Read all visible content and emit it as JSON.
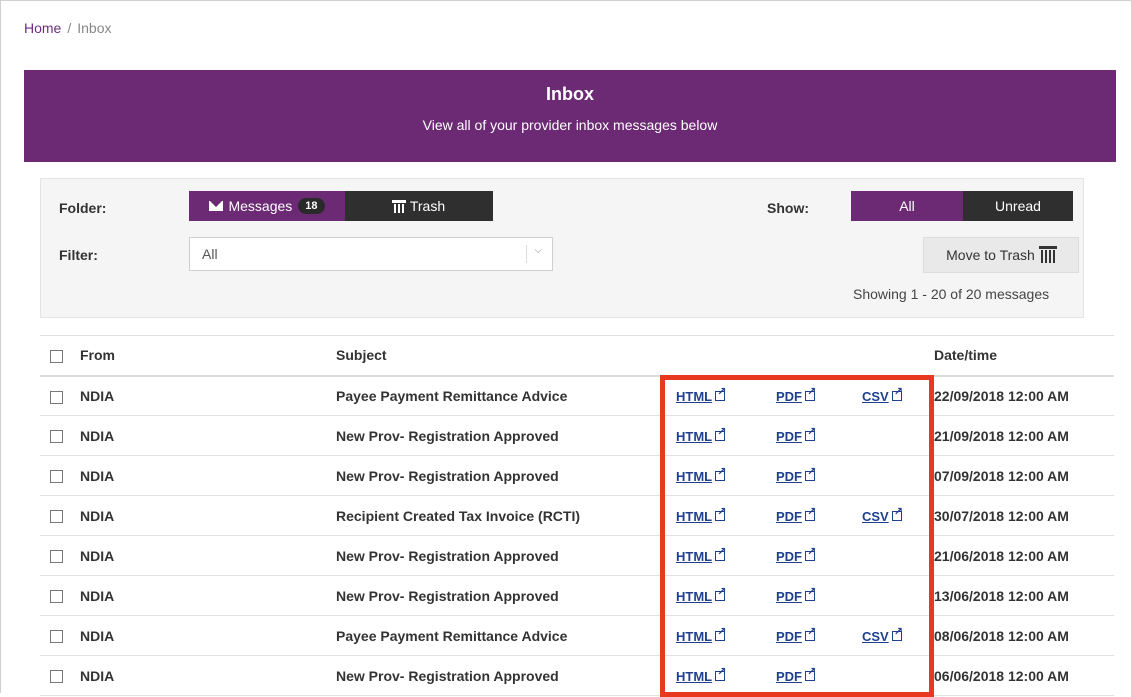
{
  "breadcrumb": {
    "home": "Home",
    "separator": "/",
    "current": "Inbox"
  },
  "banner": {
    "title": "Inbox",
    "subtitle": "View all of your provider inbox messages below"
  },
  "controls": {
    "folder_label": "Folder:",
    "messages_label": "Messages",
    "messages_count": "18",
    "trash_label": "Trash",
    "show_label": "Show:",
    "show_all": "All",
    "show_unread": "Unread",
    "filter_label": "Filter:",
    "filter_value": "All",
    "move_to_trash": "Move to Trash",
    "showing_text": "Showing 1 - 20 of 20 messages"
  },
  "table": {
    "headers": {
      "from": "From",
      "subject": "Subject",
      "datetime": "Date/time"
    },
    "links": {
      "html": "HTML",
      "pdf": "PDF",
      "csv": "CSV"
    },
    "rows": [
      {
        "from": "NDIA",
        "subject": "Payee Payment Remittance Advice",
        "csv": true,
        "datetime": "22/09/2018 12:00 AM"
      },
      {
        "from": "NDIA",
        "subject": "New Prov- Registration Approved",
        "csv": false,
        "datetime": "21/09/2018 12:00 AM"
      },
      {
        "from": "NDIA",
        "subject": "New Prov- Registration Approved",
        "csv": false,
        "datetime": "07/09/2018 12:00 AM"
      },
      {
        "from": "NDIA",
        "subject": "Recipient Created Tax Invoice (RCTI)",
        "csv": true,
        "datetime": "30/07/2018 12:00 AM"
      },
      {
        "from": "NDIA",
        "subject": "New Prov- Registration Approved",
        "csv": false,
        "datetime": "21/06/2018 12:00 AM"
      },
      {
        "from": "NDIA",
        "subject": "New Prov- Registration Approved",
        "csv": false,
        "datetime": "13/06/2018 12:00 AM"
      },
      {
        "from": "NDIA",
        "subject": "Payee Payment Remittance Advice",
        "csv": true,
        "datetime": "08/06/2018 12:00 AM"
      },
      {
        "from": "NDIA",
        "subject": "New Prov- Registration Approved",
        "csv": false,
        "datetime": "06/06/2018 12:00 AM"
      }
    ]
  },
  "colors": {
    "brand_purple": "#6b2a73",
    "dark_button": "#2f2f2f",
    "link_blue": "#1f3f8f",
    "highlight_red": "#e8391e"
  }
}
